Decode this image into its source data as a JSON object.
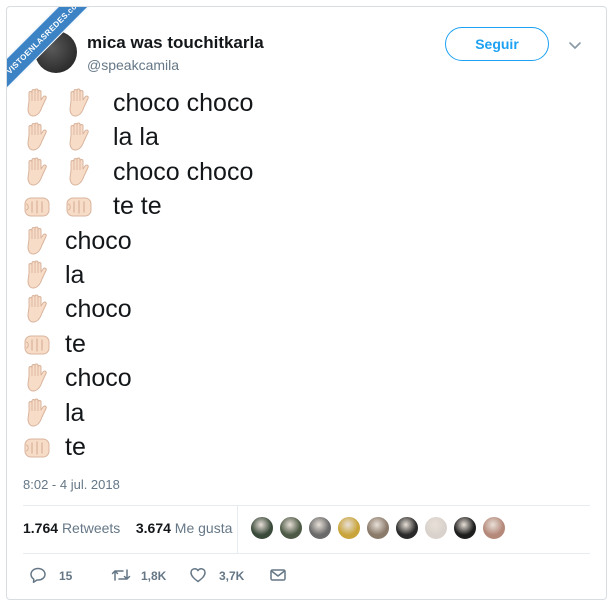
{
  "watermark": "VISTOENLASREDES.com",
  "author": {
    "display_name": "mica was touchitkarla",
    "handle": "@speakcamila"
  },
  "follow_label": "Seguir",
  "tweet_lines": [
    {
      "hands": [
        "raised",
        "raised"
      ],
      "text": "choco choco"
    },
    {
      "hands": [
        "raised",
        "raised"
      ],
      "text": "la la"
    },
    {
      "hands": [
        "raised",
        "raised"
      ],
      "text": "choco choco"
    },
    {
      "hands": [
        "fist",
        "fist"
      ],
      "text": "te te"
    },
    {
      "hands": [
        "raised"
      ],
      "text": "choco"
    },
    {
      "hands": [
        "raised"
      ],
      "text": "la"
    },
    {
      "hands": [
        "raised"
      ],
      "text": "choco"
    },
    {
      "hands": [
        "fist"
      ],
      "text": "te"
    },
    {
      "hands": [
        "raised"
      ],
      "text": "choco"
    },
    {
      "hands": [
        "raised"
      ],
      "text": "la"
    },
    {
      "hands": [
        "fist"
      ],
      "text": "te"
    }
  ],
  "timestamp": "8:02 - 4 jul. 2018",
  "stats": {
    "retweets_count": "1.764",
    "retweets_label": "Retweets",
    "likes_count": "3.674",
    "likes_label": "Me gusta"
  },
  "liker_colors": [
    "#3a4a3a",
    "#4d5a45",
    "#6a6a6a",
    "#c9a43a",
    "#8a7a6a",
    "#2a2a2a",
    "#d9d2cc",
    "#1e1e1e",
    "#b5897a"
  ],
  "actions": {
    "reply_count": "15",
    "retweet_count": "1,8K",
    "like_count": "3,7K"
  },
  "colors": {
    "accent": "#1da1f2",
    "skin": "#f7dcc8",
    "skin_line": "#d9b49c"
  }
}
